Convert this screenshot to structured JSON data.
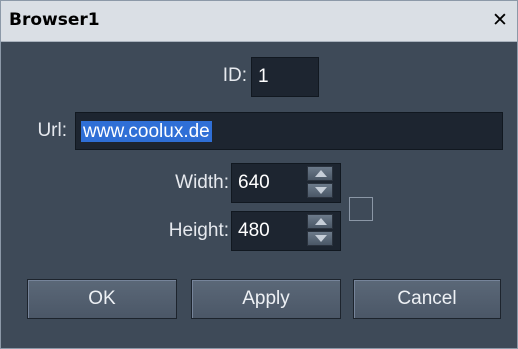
{
  "window": {
    "title": "Browser1",
    "close_glyph": "✕"
  },
  "form": {
    "id_label": "ID:",
    "id_value": "1",
    "url_label": "Url:",
    "url_value": "www.coolux.de",
    "width_label": "Width:",
    "width_value": "640",
    "height_label": "Height:",
    "height_value": "480",
    "lock_checked": false
  },
  "buttons": {
    "ok": "OK",
    "apply": "Apply",
    "cancel": "Cancel"
  },
  "icons": {
    "close": "close-icon",
    "spin_up": "arrow-up-icon",
    "spin_down": "arrow-down-icon"
  },
  "colors": {
    "selection": "#2f6fd6",
    "panel": "#3e4a58",
    "field": "#1d2530",
    "titlebar": "#dadfe5"
  }
}
